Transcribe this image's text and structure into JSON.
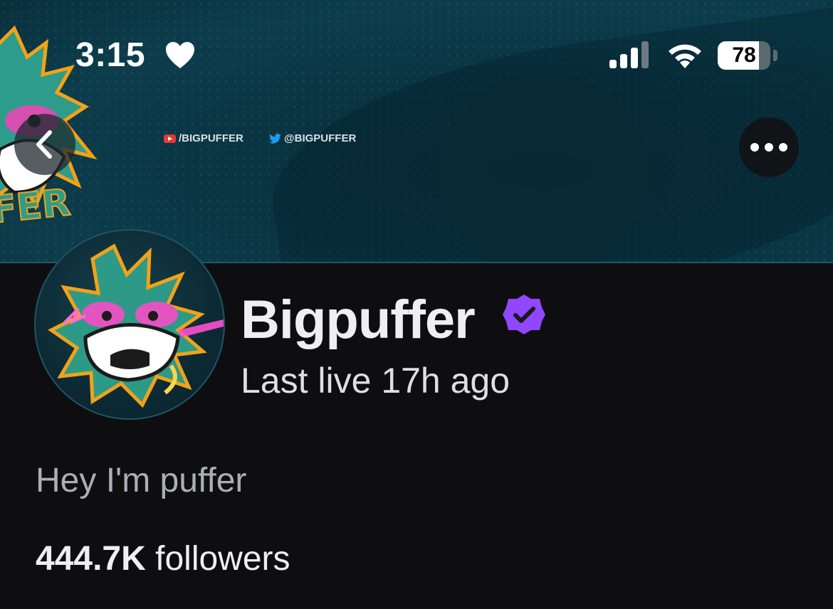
{
  "status_bar": {
    "time": "3:15",
    "battery": "78",
    "icons": [
      "heart-icon",
      "cellular-signal-icon",
      "wifi-icon",
      "battery-icon"
    ]
  },
  "banner": {
    "youtube_handle": "/BIGPUFFER",
    "twitter_handle": "@BIGPUFFER",
    "mascot_text": "FFER"
  },
  "nav": {
    "back_icon": "chevron-left-icon",
    "more_icon": "ellipsis-icon"
  },
  "profile": {
    "name": "Bigpuffer",
    "verified": true,
    "last_live": "Last live 17h ago",
    "bio": "Hey I'm puffer",
    "followers_count": "444.7K",
    "followers_label": "followers"
  },
  "colors": {
    "background": "#0e0e10",
    "banner": "#0a3442",
    "verified_badge": "#9146ff",
    "text_primary": "#efeff1",
    "text_secondary": "#adadb8"
  }
}
